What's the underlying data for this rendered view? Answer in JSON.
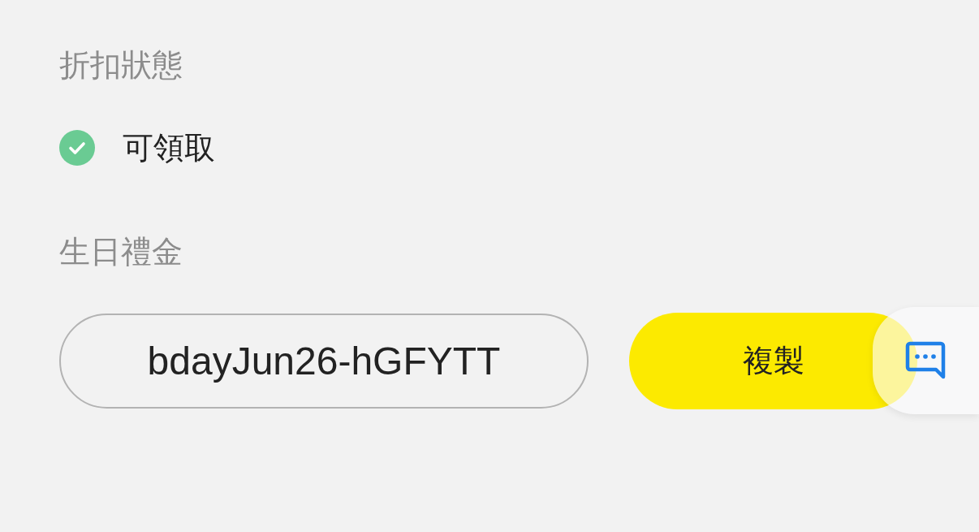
{
  "discount_status": {
    "label": "折扣狀態",
    "status": {
      "text": "可領取",
      "available": true
    }
  },
  "birthday_gift": {
    "label": "生日禮金",
    "code": "bdayJun26-hGFYTT",
    "copy_button": "複製"
  }
}
